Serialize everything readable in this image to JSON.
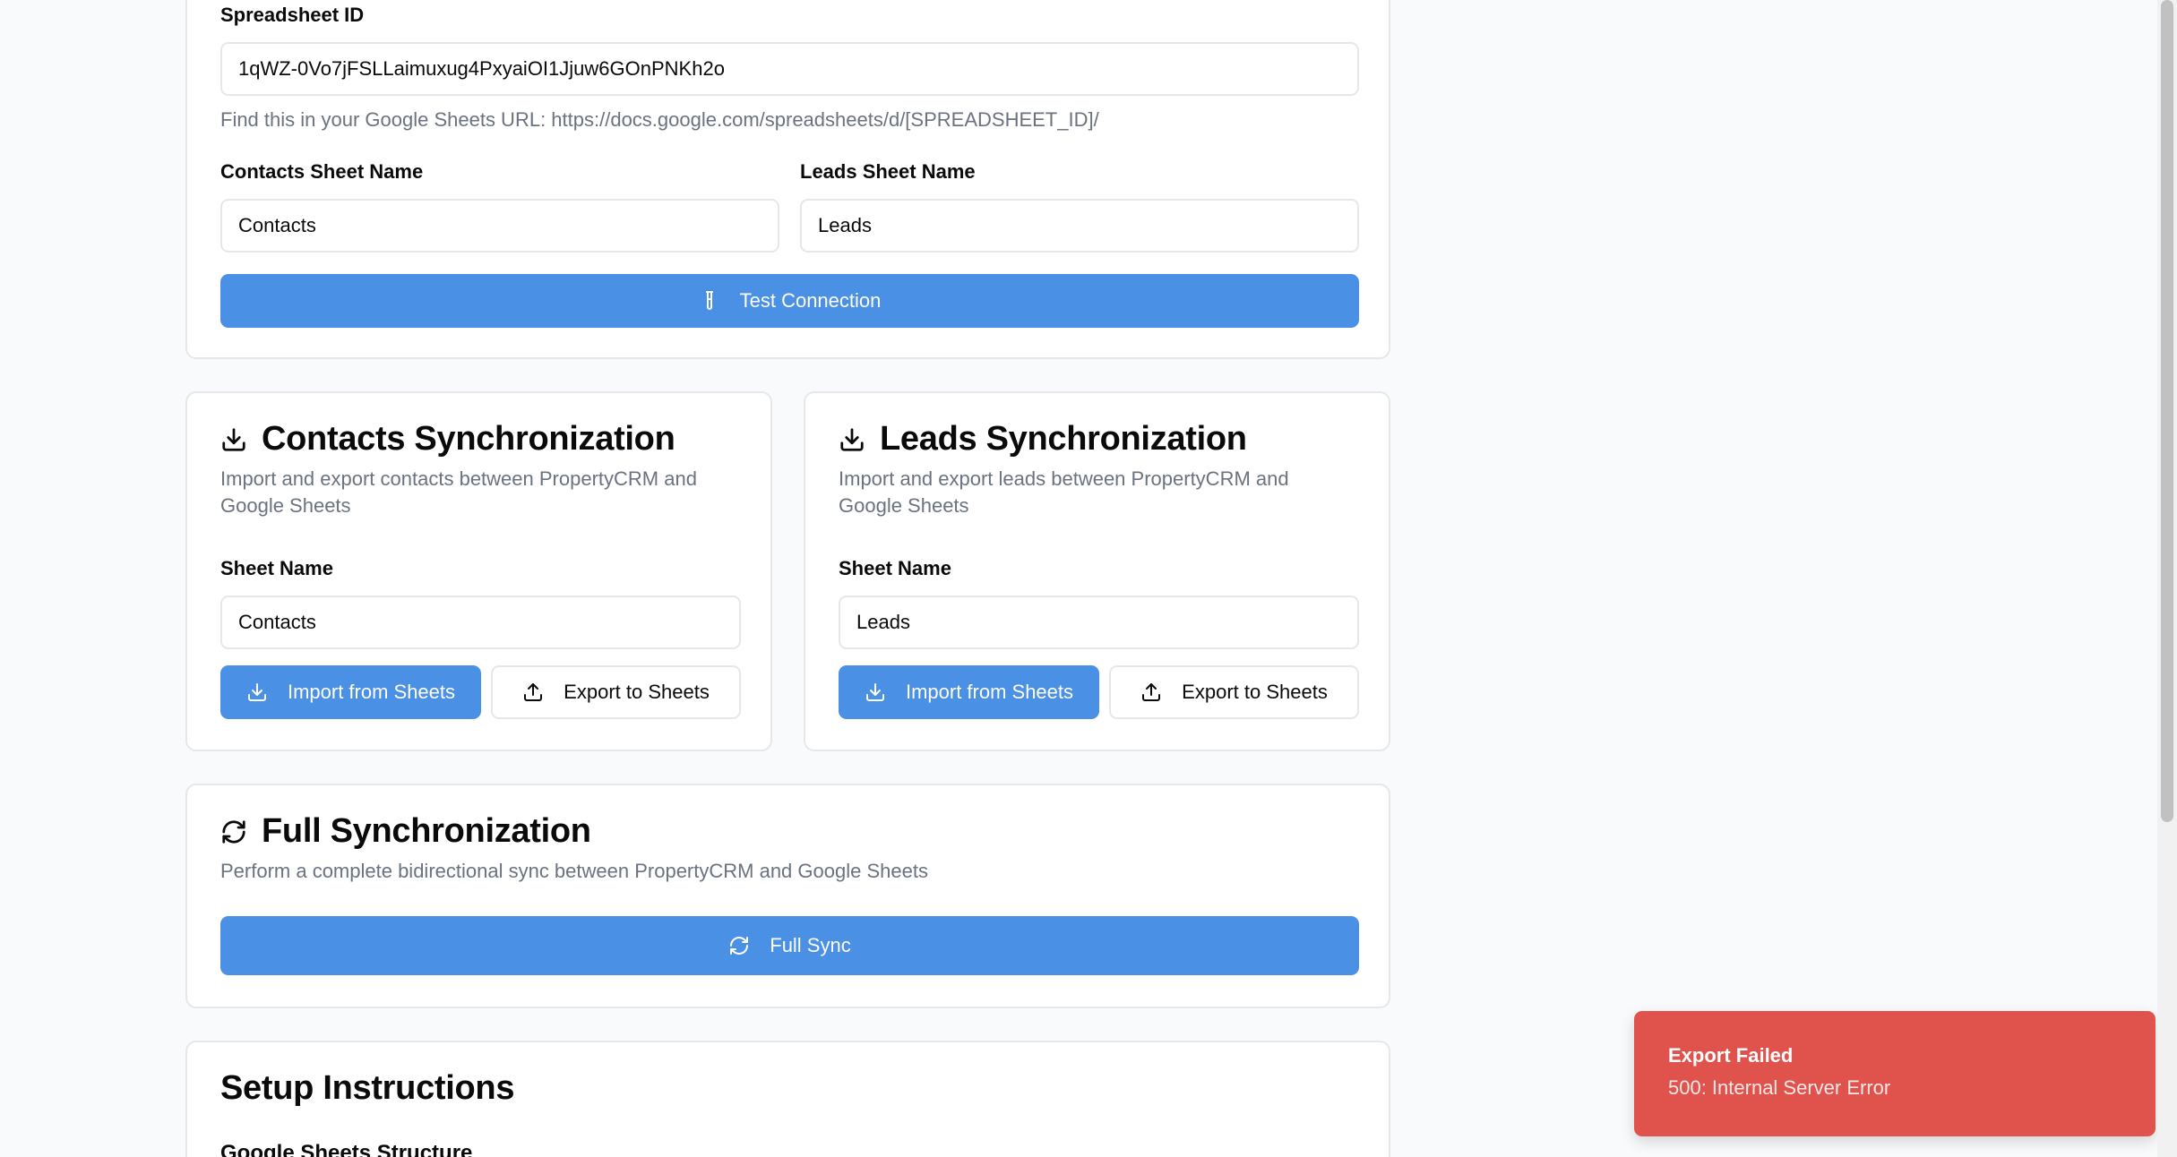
{
  "connection": {
    "spreadsheet_id_label": "Spreadsheet ID",
    "spreadsheet_id_value": "1qWZ-0Vo7jFSLLaimuxug4PxyaiOI1Jjuw6GOnPNKh2o",
    "spreadsheet_help": "Find this in your Google Sheets URL: https://docs.google.com/spreadsheets/d/[SPREADSHEET_ID]/",
    "contacts_sheet_label": "Contacts Sheet Name",
    "contacts_sheet_value": "Contacts",
    "leads_sheet_label": "Leads Sheet Name",
    "leads_sheet_value": "Leads",
    "test_button": "Test Connection"
  },
  "contacts_sync": {
    "title": "Contacts Synchronization",
    "description": "Import and export contacts between PropertyCRM and Google Sheets",
    "sheet_label": "Sheet Name",
    "sheet_value": "Contacts",
    "import_button": "Import from Sheets",
    "export_button": "Export to Sheets"
  },
  "leads_sync": {
    "title": "Leads Synchronization",
    "description": "Import and export leads between PropertyCRM and Google Sheets",
    "sheet_label": "Sheet Name",
    "sheet_value": "Leads",
    "import_button": "Import from Sheets",
    "export_button": "Export to Sheets"
  },
  "full_sync": {
    "title": "Full Synchronization",
    "description": "Perform a complete bidirectional sync between PropertyCRM and Google Sheets",
    "button": "Full Sync"
  },
  "setup": {
    "title": "Setup Instructions",
    "subtitle": "Google Sheets Structure"
  },
  "toast": {
    "title": "Export Failed",
    "message": "500: Internal Server Error"
  },
  "colors": {
    "primary": "#4a90e5",
    "destructive": "#e0534d",
    "muted_text": "#6b7280",
    "border": "#e5e7eb"
  },
  "icons": {
    "test": "test-tube-icon",
    "download": "download-icon",
    "upload": "upload-icon",
    "refresh": "refresh-icon"
  }
}
